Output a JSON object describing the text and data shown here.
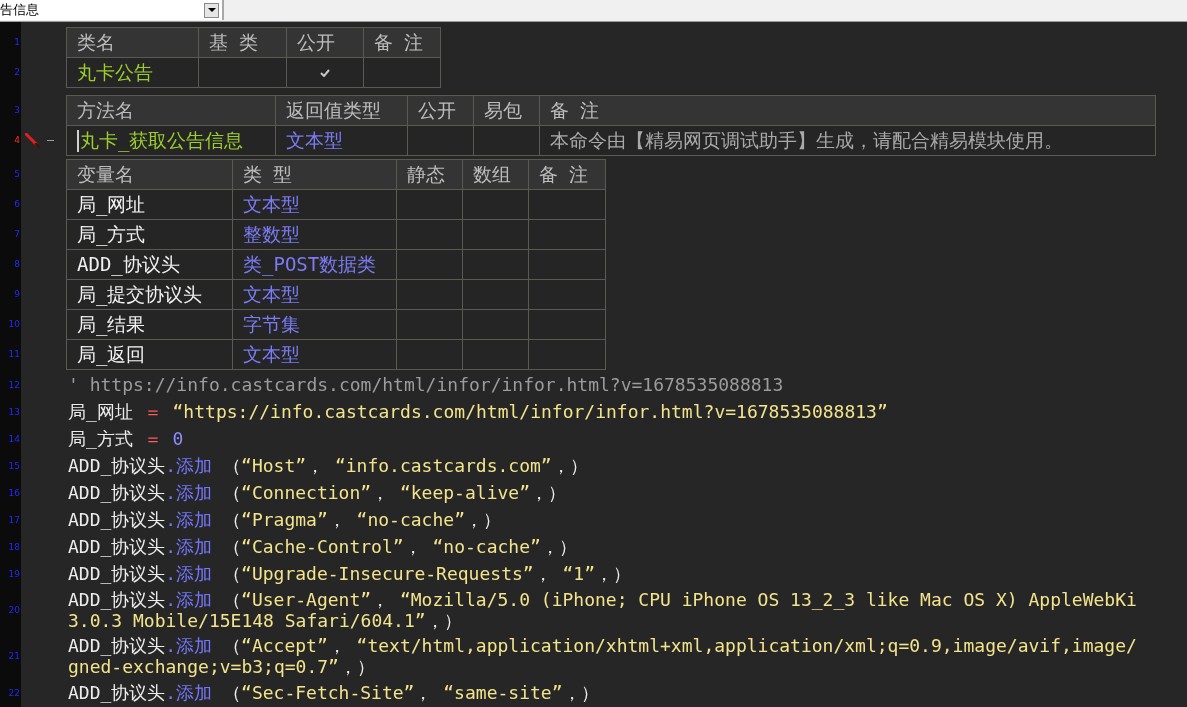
{
  "top_bar": {
    "dropdown": {
      "value": "告信息"
    }
  },
  "class_table": {
    "header": {
      "line_number": "1",
      "cells": [
        "类名",
        "基 类",
        "公开",
        "备 注"
      ]
    },
    "rows": [
      {
        "line_number": "2",
        "name": "丸卡公告",
        "public": true
      }
    ]
  },
  "method_table": {
    "header": {
      "line_number": "3",
      "cells": [
        "方法名",
        "返回值类型",
        "公开",
        "易包",
        "备 注"
      ]
    },
    "rows": [
      {
        "line_number": "4",
        "editing": true,
        "name": "丸卡_获取公告信息",
        "return_type": "文本型",
        "public": false,
        "note": "本命令由【精易网页调试助手】生成，请配合精易模块使用。"
      }
    ]
  },
  "variable_table": {
    "header": {
      "line_number": "5",
      "cells": [
        "变量名",
        "类 型",
        "静态",
        "数组",
        "备 注"
      ]
    },
    "rows": [
      {
        "line_number": "6",
        "name": "局_网址",
        "type": "文本型"
      },
      {
        "line_number": "7",
        "name": "局_方式",
        "type": "整数型"
      },
      {
        "line_number": "8",
        "name": "ADD_协议头",
        "type": "类_POST数据类"
      },
      {
        "line_number": "9",
        "name": "局_提交协议头",
        "type": "文本型"
      },
      {
        "line_number": "10",
        "name": "局_结果",
        "type": "字节集"
      },
      {
        "line_number": "11",
        "name": "局_返回",
        "type": "文本型"
      }
    ]
  },
  "code_lines": [
    {
      "line_number": "12",
      "segments": [
        {
          "kind": "comment",
          "text": "' https://info.castcards.com/html/infor/infor.html?v=1678535088813"
        }
      ]
    },
    {
      "line_number": "13",
      "segments": [
        {
          "kind": "ident",
          "text": "局_网址"
        },
        {
          "kind": "op",
          "text": " ＝ "
        },
        {
          "kind": "string",
          "text": "“https://info.castcards.com/html/infor/infor.html?v=1678535088813”"
        }
      ]
    },
    {
      "line_number": "14",
      "segments": [
        {
          "kind": "ident",
          "text": "局_方式"
        },
        {
          "kind": "op",
          "text": " ＝ "
        },
        {
          "kind": "number",
          "text": "0"
        }
      ]
    },
    {
      "line_number": "15",
      "segments": [
        {
          "kind": "ident",
          "text": "ADD_协议头"
        },
        {
          "kind": "method",
          "text": ".添加"
        },
        {
          "kind": "plain",
          "text": " （"
        },
        {
          "kind": "string",
          "text": "“Host”"
        },
        {
          "kind": "plain",
          "text": "， "
        },
        {
          "kind": "string",
          "text": "“info.castcards.com”"
        },
        {
          "kind": "plain",
          "text": "，）"
        }
      ]
    },
    {
      "line_number": "16",
      "segments": [
        {
          "kind": "ident",
          "text": "ADD_协议头"
        },
        {
          "kind": "method",
          "text": ".添加"
        },
        {
          "kind": "plain",
          "text": " （"
        },
        {
          "kind": "string",
          "text": "“Connection”"
        },
        {
          "kind": "plain",
          "text": "， "
        },
        {
          "kind": "string",
          "text": "“keep-alive”"
        },
        {
          "kind": "plain",
          "text": "，）"
        }
      ]
    },
    {
      "line_number": "17",
      "segments": [
        {
          "kind": "ident",
          "text": "ADD_协议头"
        },
        {
          "kind": "method",
          "text": ".添加"
        },
        {
          "kind": "plain",
          "text": " （"
        },
        {
          "kind": "string",
          "text": "“Pragma”"
        },
        {
          "kind": "plain",
          "text": "， "
        },
        {
          "kind": "string",
          "text": "“no-cache”"
        },
        {
          "kind": "plain",
          "text": "，）"
        }
      ]
    },
    {
      "line_number": "18",
      "segments": [
        {
          "kind": "ident",
          "text": "ADD_协议头"
        },
        {
          "kind": "method",
          "text": ".添加"
        },
        {
          "kind": "plain",
          "text": " （"
        },
        {
          "kind": "string",
          "text": "“Cache-Control”"
        },
        {
          "kind": "plain",
          "text": "， "
        },
        {
          "kind": "string",
          "text": "“no-cache”"
        },
        {
          "kind": "plain",
          "text": "，）"
        }
      ]
    },
    {
      "line_number": "19",
      "segments": [
        {
          "kind": "ident",
          "text": "ADD_协议头"
        },
        {
          "kind": "method",
          "text": ".添加"
        },
        {
          "kind": "plain",
          "text": " （"
        },
        {
          "kind": "string",
          "text": "“Upgrade-Insecure-Requests”"
        },
        {
          "kind": "plain",
          "text": "， "
        },
        {
          "kind": "string",
          "text": "“1”"
        },
        {
          "kind": "plain",
          "text": "，）"
        }
      ]
    },
    {
      "line_number": "20",
      "segments": [
        {
          "kind": "ident",
          "text": "ADD_协议头"
        },
        {
          "kind": "method",
          "text": ".添加"
        },
        {
          "kind": "plain",
          "text": " （"
        },
        {
          "kind": "string",
          "text": "“User-Agent”"
        },
        {
          "kind": "plain",
          "text": "， "
        },
        {
          "kind": "string",
          "text": "“Mozilla/5.0 (iPhone; CPU iPhone OS 13_2_3 like Mac OS X) AppleWebKi"
        }
      ],
      "continuation": [
        {
          "kind": "string",
          "text": "3.0.3 Mobile/15E148 Safari/604.1”"
        },
        {
          "kind": "plain",
          "text": "，）"
        }
      ]
    },
    {
      "line_number": "21",
      "segments": [
        {
          "kind": "ident",
          "text": "ADD_协议头"
        },
        {
          "kind": "method",
          "text": ".添加"
        },
        {
          "kind": "plain",
          "text": " （"
        },
        {
          "kind": "string",
          "text": "“Accept”"
        },
        {
          "kind": "plain",
          "text": "， "
        },
        {
          "kind": "string",
          "text": "“text/html,application/xhtml+xml,application/xml;q=0.9,image/avif,image/"
        }
      ],
      "continuation": [
        {
          "kind": "string",
          "text": "gned-exchange;v=b3;q=0.7”"
        },
        {
          "kind": "plain",
          "text": "，）"
        }
      ]
    },
    {
      "line_number": "22",
      "segments": [
        {
          "kind": "ident",
          "text": "ADD_协议头"
        },
        {
          "kind": "method",
          "text": ".添加"
        },
        {
          "kind": "plain",
          "text": " （"
        },
        {
          "kind": "string",
          "text": "“Sec-Fetch-Site”"
        },
        {
          "kind": "plain",
          "text": "， "
        },
        {
          "kind": "string",
          "text": "“same-site”"
        },
        {
          "kind": "plain",
          "text": "，）"
        }
      ]
    }
  ]
}
